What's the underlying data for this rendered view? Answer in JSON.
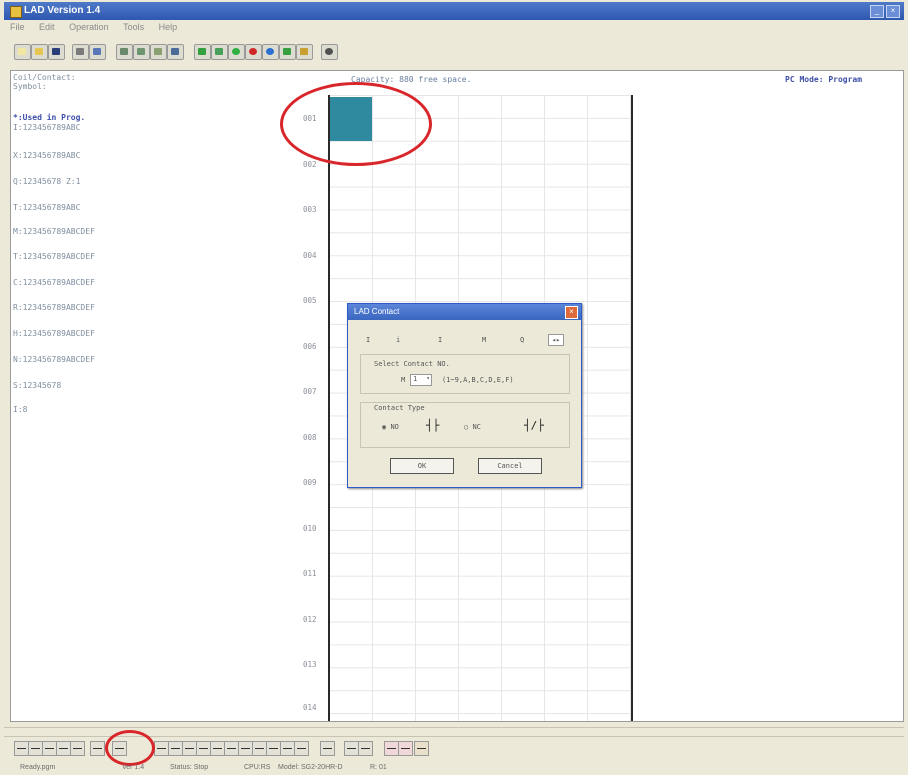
{
  "window": {
    "title": "LAD Version 1.4",
    "colors": {
      "titlebar": "#2e58b0",
      "cursor": "#2f8aa0",
      "annotation": "#d8262a"
    }
  },
  "menu": [
    "File",
    "Edit",
    "Operation",
    "Tools",
    "Help"
  ],
  "workspace": {
    "header_left": [
      "Coil/Contact:",
      "Symbol:"
    ],
    "used_title": "*:Used in Prog.",
    "used_list": [
      "I:123456789ABC",
      "X:123456789ABC",
      "Q:12345678 Z:1",
      "T:123456789ABC",
      "M:123456789ABCDEF",
      "T:123456789ABCDEF",
      "C:123456789ABCDEF",
      "R:123456789ABCDEF",
      "H:123456789ABCDEF",
      "N:123456789ABCDEF",
      "S:12345678",
      "I:8"
    ],
    "capacity": "Capacity: 880 free space.",
    "pc_mode": "PC Mode: Program",
    "rows": [
      "001",
      "002",
      "003",
      "004",
      "005",
      "006",
      "007",
      "008",
      "009",
      "010",
      "011",
      "012",
      "013",
      "014"
    ]
  },
  "dialog": {
    "title": "LAD Contact",
    "top_row": [
      "I",
      "i",
      "I",
      "M",
      "Q",
      "S"
    ],
    "select_label": "Select Contact NO.",
    "select_prefix": "M",
    "select_value": "1",
    "select_range": "(1~9,A,B,C,D,E,F)",
    "type_label": "Contact Type",
    "type_no": "NO",
    "type_nc": "NC",
    "ok": "OK",
    "cancel": "Cancel"
  },
  "status": [
    "Ready.pgm",
    "Ver 1.4",
    "Status: Stop",
    "CPU:RS",
    "Model: SG2-20HR-D",
    "R: 01"
  ],
  "icons": [
    "new-icon",
    "open-icon",
    "save-icon",
    "print-icon",
    "preview-icon",
    "monitor-icon",
    "run-icon",
    "stop-icon",
    "contact-icon",
    "coil-icon",
    "line-icon",
    "delete-icon"
  ]
}
